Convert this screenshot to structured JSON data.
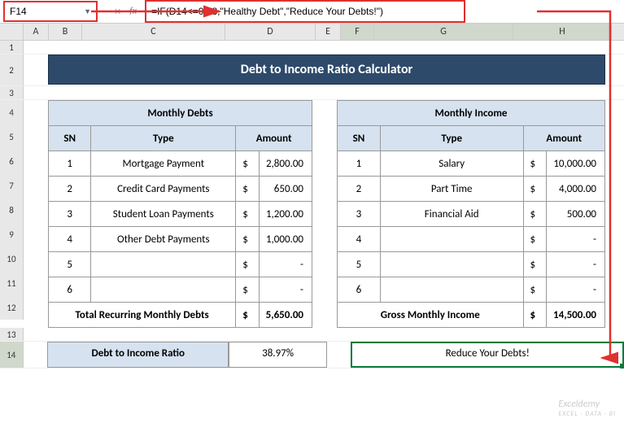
{
  "nameBox": "F14",
  "formula": "=IF(D14<=0.28,\"Healthy Debt\",\"Reduce Your Debts!\")",
  "fxLabel": "fx",
  "cols": {
    "A": "A",
    "B": "B",
    "C": "C",
    "D": "D",
    "E": "E",
    "F": "F",
    "G": "G",
    "H": "H"
  },
  "title": "Debt to Income Ratio Calculator",
  "debts": {
    "header": "Monthly Debts",
    "snLabel": "SN",
    "typeLabel": "Type",
    "amountLabel": "Amount",
    "rows": [
      {
        "sn": "1",
        "type": "Mortgage Payment",
        "amount": "2,800.00"
      },
      {
        "sn": "2",
        "type": "Credit Card Payments",
        "amount": "650.00"
      },
      {
        "sn": "3",
        "type": "Student Loan Payments",
        "amount": "1,200.00"
      },
      {
        "sn": "4",
        "type": "Other Debt Payments",
        "amount": "1,000.00"
      },
      {
        "sn": "5",
        "type": "",
        "amount": "-"
      },
      {
        "sn": "6",
        "type": "",
        "amount": "-"
      }
    ],
    "totalLabel": "Total Recurring Monthly Debts",
    "totalAmount": "5,650.00"
  },
  "income": {
    "header": "Monthly Income",
    "snLabel": "SN",
    "typeLabel": "Type",
    "amountLabel": "Amount",
    "rows": [
      {
        "sn": "1",
        "type": "Salary",
        "amount": "10,000.00"
      },
      {
        "sn": "2",
        "type": "Part Time",
        "amount": "4,000.00"
      },
      {
        "sn": "3",
        "type": "Financial Aid",
        "amount": "500.00"
      },
      {
        "sn": "4",
        "type": "",
        "amount": "-"
      },
      {
        "sn": "5",
        "type": "",
        "amount": "-"
      },
      {
        "sn": "6",
        "type": "",
        "amount": "-"
      }
    ],
    "totalLabel": "Gross Monthly Income",
    "totalAmount": "14,500.00"
  },
  "ratio": {
    "label": "Debt to Income Ratio",
    "value": "38.97%"
  },
  "result": "Reduce Your Debts!",
  "dollar": "$",
  "watermark": {
    "main": "Exceldemy",
    "sub": "EXCEL · DATA · BI"
  }
}
